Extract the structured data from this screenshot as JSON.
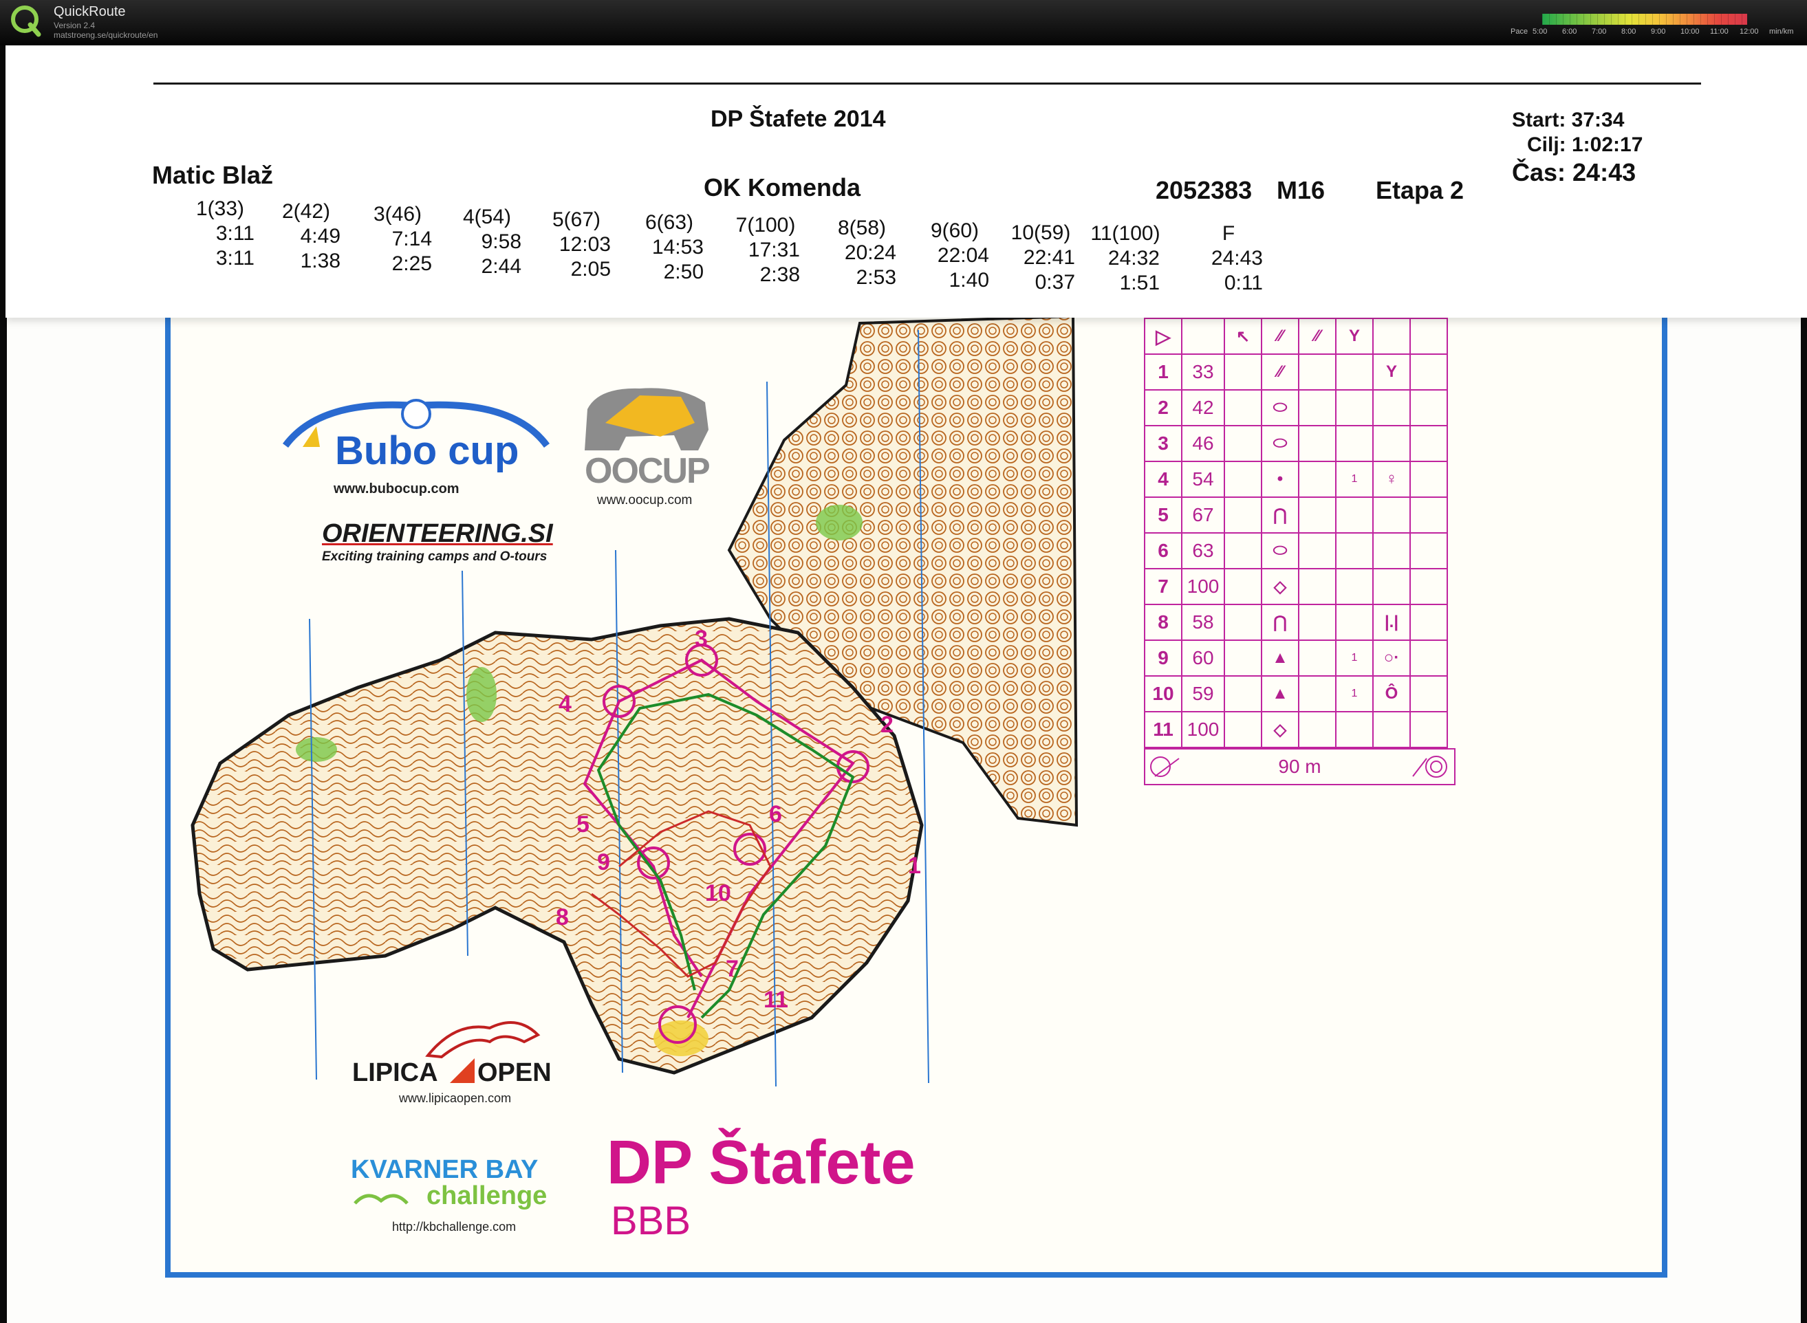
{
  "app": {
    "name": "QuickRoute",
    "version": "Version 2.4",
    "url": "matstroeng.se/quickroute/en"
  },
  "pace_legend": {
    "label": "Pace",
    "ticks": [
      "5:00",
      "6:00",
      "7:00",
      "8:00",
      "9:00",
      "10:00",
      "11:00",
      "12:00"
    ],
    "unit": "min/km"
  },
  "result_strip": {
    "event": "DP Štafete 2014",
    "runner": "Matic Blaž",
    "club": "OK Komenda",
    "card": "2052383",
    "class": "M16",
    "stage": "Etapa 2",
    "start": "Start: 37:34",
    "finish": "Cilj: 1:02:17",
    "total": "Čas: 24:43",
    "splits": [
      {
        "control": "1(33)",
        "cumulative": "3:11",
        "leg": "3:11"
      },
      {
        "control": "2(42)",
        "cumulative": "4:49",
        "leg": "1:38"
      },
      {
        "control": "3(46)",
        "cumulative": "7:14",
        "leg": "2:25"
      },
      {
        "control": "4(54)",
        "cumulative": "9:58",
        "leg": "2:44"
      },
      {
        "control": "5(67)",
        "cumulative": "12:03",
        "leg": "2:05"
      },
      {
        "control": "6(63)",
        "cumulative": "14:53",
        "leg": "2:50"
      },
      {
        "control": "7(100)",
        "cumulative": "17:31",
        "leg": "2:38"
      },
      {
        "control": "8(58)",
        "cumulative": "20:24",
        "leg": "2:53"
      },
      {
        "control": "9(60)",
        "cumulative": "22:04",
        "leg": "1:40"
      },
      {
        "control": "10(59)",
        "cumulative": "22:41",
        "leg": "0:37"
      },
      {
        "control": "11(100)",
        "cumulative": "24:32",
        "leg": "1:51"
      },
      {
        "control": "F",
        "cumulative": "24:43",
        "leg": "0:11"
      }
    ]
  },
  "map": {
    "sponsors": {
      "bubo": "Bubo cup",
      "bubo_url": "www.bubocup.com",
      "oocup": "OOCUP",
      "oocup_url": "www.oocup.com",
      "orienteering": "ORIENTEERING.SI",
      "orienteering_sub": "Exciting training camps and O-tours",
      "lipica_a": "LIPICA",
      "lipica_b": "OPEN",
      "lipica_url": "www.lipicaopen.com",
      "kvarner": "KVARNER BAY",
      "kvarner_sub": "challenge",
      "kvarner_url": "http://kbchallenge.com"
    },
    "title": "DP Štafete",
    "subtitle": "BBB",
    "course_numbers": [
      "1",
      "2",
      "3",
      "4",
      "5",
      "6",
      "7",
      "8",
      "9",
      "10",
      "11"
    ],
    "colors": {
      "course": "#d0158a",
      "route": "#1c8c2a",
      "border": "#2a76d0",
      "contour": "#b8651e"
    }
  },
  "control_descriptions": {
    "rows": [
      {
        "n": "1",
        "code": "33"
      },
      {
        "n": "2",
        "code": "42"
      },
      {
        "n": "3",
        "code": "46"
      },
      {
        "n": "4",
        "code": "54"
      },
      {
        "n": "5",
        "code": "67"
      },
      {
        "n": "6",
        "code": "63"
      },
      {
        "n": "7",
        "code": "100"
      },
      {
        "n": "8",
        "code": "58"
      },
      {
        "n": "9",
        "code": "60"
      },
      {
        "n": "10",
        "code": "59"
      },
      {
        "n": "11",
        "code": "100"
      }
    ],
    "distance": "90 m"
  }
}
